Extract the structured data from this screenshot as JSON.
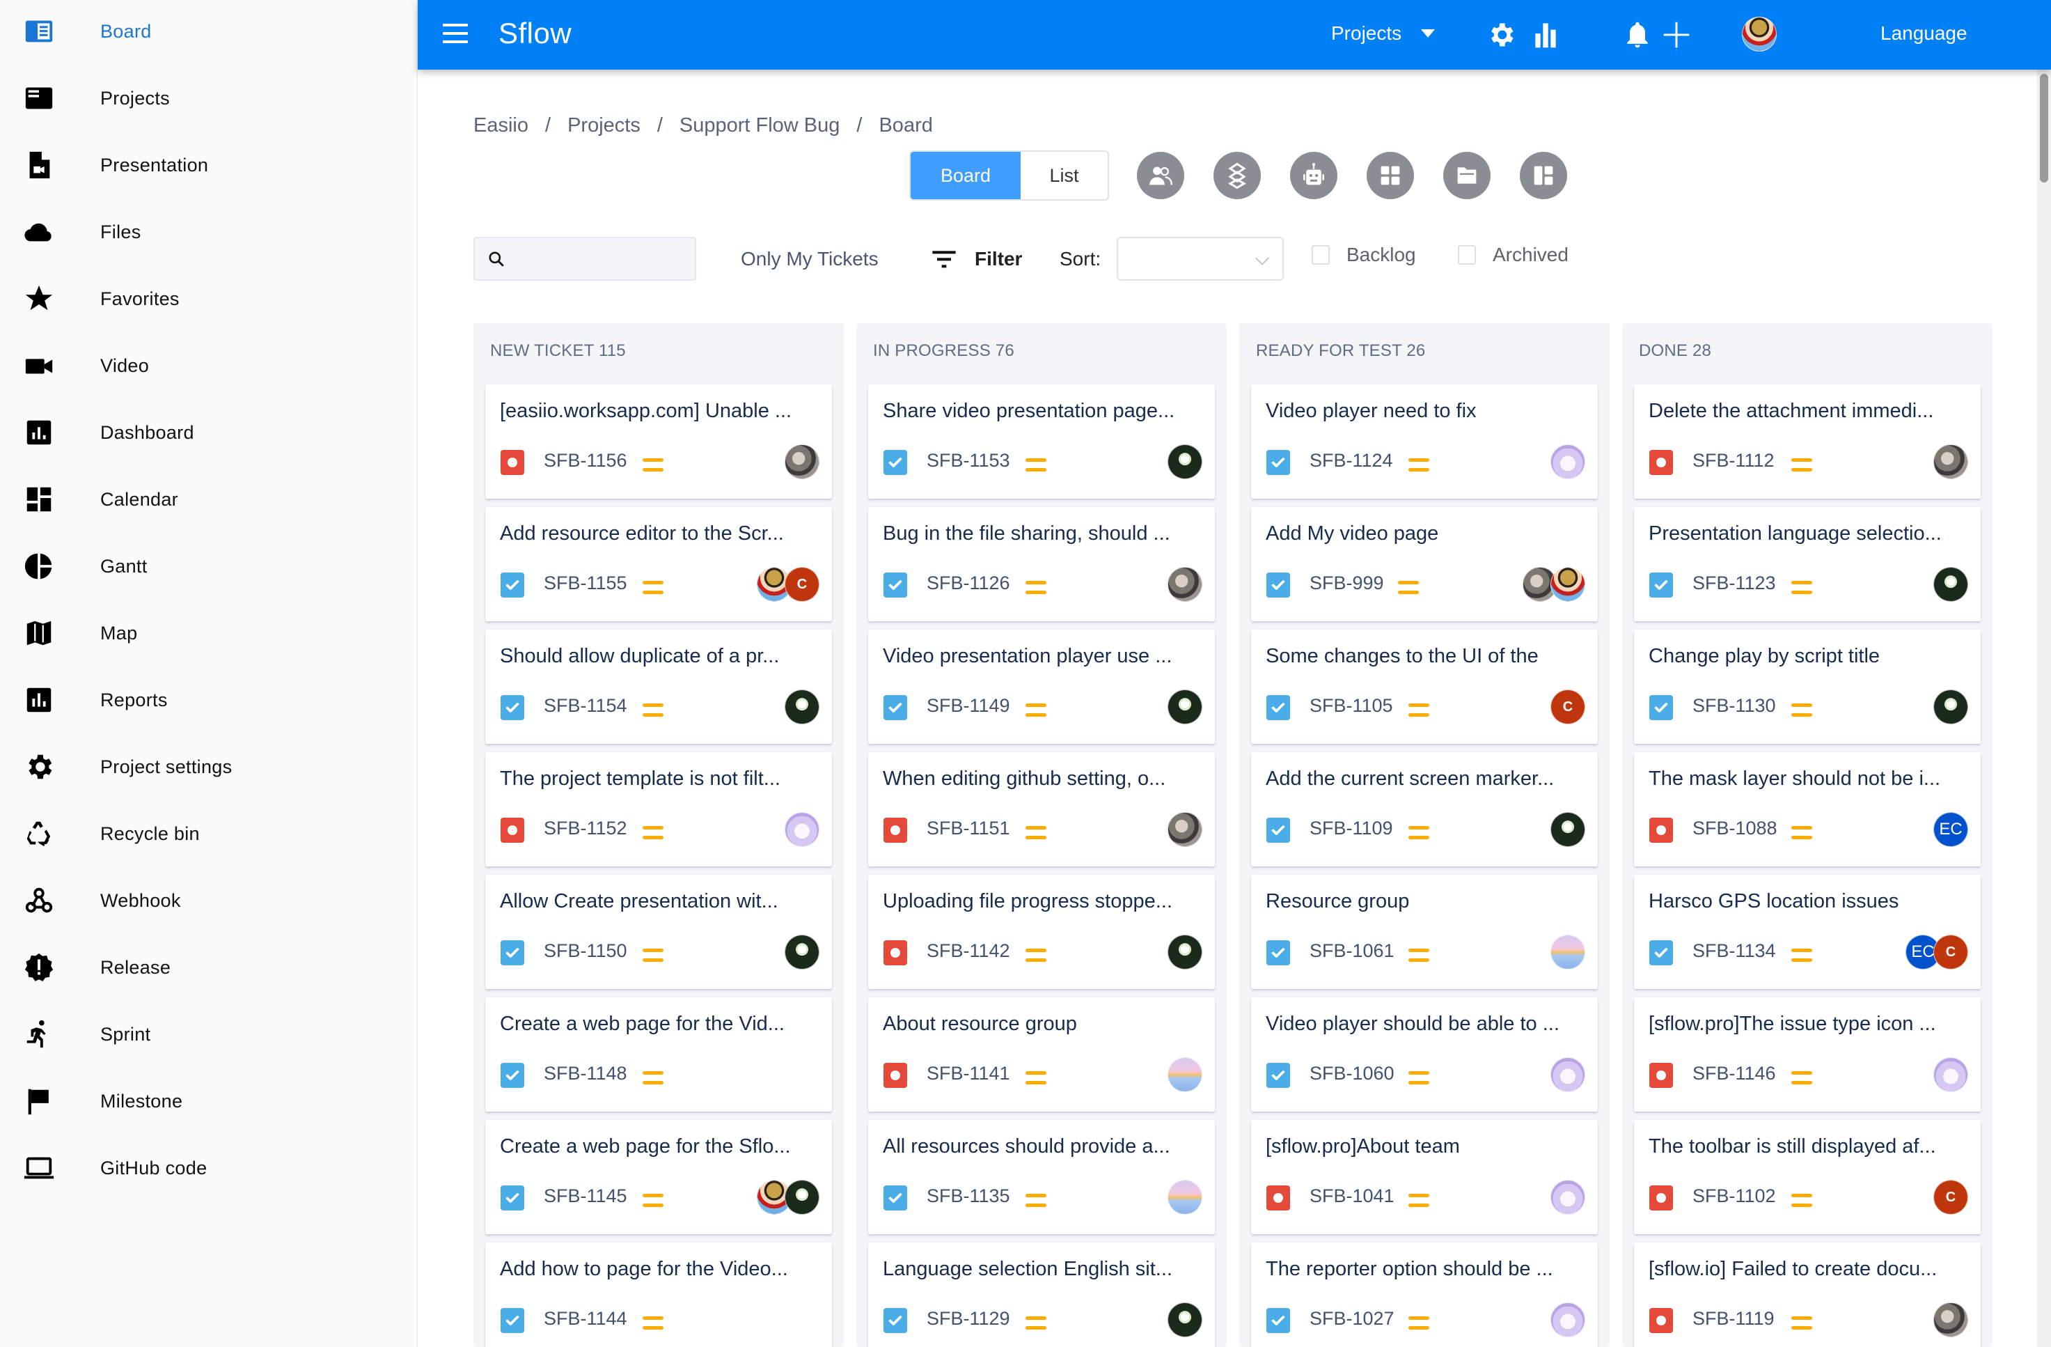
{
  "sidebar": {
    "items": [
      {
        "label": "Board",
        "icon": "board-icon",
        "active": true
      },
      {
        "label": "Projects",
        "icon": "projects-icon"
      },
      {
        "label": "Presentation",
        "icon": "presentation-icon"
      },
      {
        "label": "Files",
        "icon": "cloud-icon"
      },
      {
        "label": "Favorites",
        "icon": "star-icon"
      },
      {
        "label": "Video",
        "icon": "video-camera-icon"
      },
      {
        "label": "Dashboard",
        "icon": "dashboard-icon"
      },
      {
        "label": "Calendar",
        "icon": "calendar-grid-icon"
      },
      {
        "label": "Gantt",
        "icon": "pie-chart-icon"
      },
      {
        "label": "Map",
        "icon": "map-icon"
      },
      {
        "label": "Reports",
        "icon": "reports-icon"
      },
      {
        "label": "Project settings",
        "icon": "gear-icon"
      },
      {
        "label": "Recycle bin",
        "icon": "recycle-icon"
      },
      {
        "label": "Webhook",
        "icon": "webhook-icon"
      },
      {
        "label": "Release",
        "icon": "release-badge-icon"
      },
      {
        "label": "Sprint",
        "icon": "running-person-icon"
      },
      {
        "label": "Milestone",
        "icon": "flag-icon"
      },
      {
        "label": "GitHub code",
        "icon": "laptop-icon"
      }
    ]
  },
  "header": {
    "app_title": "Sflow",
    "projects_menu": "Projects",
    "language": "Language",
    "brand_color": "#0080f6"
  },
  "breadcrumb": [
    "Easiio",
    "Projects",
    "Support Flow Bug",
    "Board"
  ],
  "view_toggle": {
    "board": "Board",
    "list": "List",
    "active": "Board"
  },
  "toolbar": {
    "search_placeholder": "",
    "search_value": "",
    "only_my_tickets": "Only My Tickets",
    "filter": "Filter",
    "sort_label": "Sort:",
    "sort_value": "",
    "backlog": {
      "label": "Backlog",
      "checked": false
    },
    "archived": {
      "label": "Archived",
      "checked": false
    }
  },
  "columns": [
    {
      "title": "NEW TICKET 115",
      "cards": [
        {
          "title": "[easiio.worksapp.com] Unable ...",
          "key": "SFB-1156",
          "type": "bug",
          "priority": "medium",
          "assignees": [
            "gray"
          ]
        },
        {
          "title": "Add resource editor to the Scr...",
          "key": "SFB-1155",
          "type": "task",
          "priority": "medium",
          "assignees": [
            "luffy",
            "c"
          ]
        },
        {
          "title": "Should allow duplicate of a pr...",
          "key": "SFB-1154",
          "type": "task",
          "priority": "medium",
          "assignees": [
            "lotus"
          ]
        },
        {
          "title": "The project template is not filt...",
          "key": "SFB-1152",
          "type": "bug",
          "priority": "medium",
          "assignees": [
            "anime"
          ]
        },
        {
          "title": "Allow Create presentation wit...",
          "key": "SFB-1150",
          "type": "task",
          "priority": "medium",
          "assignees": [
            "lotus"
          ]
        },
        {
          "title": "Create a web page for the Vid...",
          "key": "SFB-1148",
          "type": "task",
          "priority": "medium",
          "assignees": []
        },
        {
          "title": "Create a web page for the Sflo...",
          "key": "SFB-1145",
          "type": "task",
          "priority": "medium",
          "assignees": [
            "luffy",
            "lotus"
          ]
        },
        {
          "title": "Add how to page for the Video...",
          "key": "SFB-1144",
          "type": "task",
          "priority": "medium",
          "assignees": []
        }
      ]
    },
    {
      "title": "IN PROGRESS 76",
      "cards": [
        {
          "title": "Share video presentation page...",
          "key": "SFB-1153",
          "type": "task",
          "priority": "medium",
          "assignees": [
            "lotus"
          ]
        },
        {
          "title": "Bug in the file sharing, should ...",
          "key": "SFB-1126",
          "type": "task",
          "priority": "medium",
          "assignees": [
            "gray"
          ]
        },
        {
          "title": "Video presentation player use ...",
          "key": "SFB-1149",
          "type": "task",
          "priority": "medium",
          "assignees": [
            "lotus"
          ]
        },
        {
          "title": "When editing github setting, o...",
          "key": "SFB-1151",
          "type": "bug",
          "priority": "medium",
          "assignees": [
            "gray"
          ]
        },
        {
          "title": "Uploading file progress stoppe...",
          "key": "SFB-1142",
          "type": "bug",
          "priority": "medium",
          "assignees": [
            "lotus"
          ]
        },
        {
          "title": "About resource group",
          "key": "SFB-1141",
          "type": "bug",
          "priority": "medium",
          "assignees": [
            "sky"
          ]
        },
        {
          "title": "All resources should provide a...",
          "key": "SFB-1135",
          "type": "task",
          "priority": "medium",
          "assignees": [
            "sky"
          ]
        },
        {
          "title": "Language selection English sit...",
          "key": "SFB-1129",
          "type": "task",
          "priority": "medium",
          "assignees": [
            "lotus"
          ]
        }
      ]
    },
    {
      "title": "READY FOR TEST 26",
      "cards": [
        {
          "title": "Video player need to fix",
          "key": "SFB-1124",
          "type": "task",
          "priority": "medium",
          "assignees": [
            "anime"
          ]
        },
        {
          "title": "Add My video page",
          "key": "SFB-999",
          "type": "task",
          "priority": "medium",
          "assignees": [
            "gray",
            "luffy"
          ]
        },
        {
          "title": "Some changes to the UI of the",
          "key": "SFB-1105",
          "type": "task",
          "priority": "medium",
          "assignees": [
            "c"
          ]
        },
        {
          "title": "Add the current screen marker...",
          "key": "SFB-1109",
          "type": "task",
          "priority": "medium",
          "assignees": [
            "lotus"
          ]
        },
        {
          "title": "Resource group",
          "key": "SFB-1061",
          "type": "task",
          "priority": "medium",
          "assignees": [
            "sky"
          ]
        },
        {
          "title": "Video player should be able to ...",
          "key": "SFB-1060",
          "type": "task",
          "priority": "medium",
          "assignees": [
            "anime"
          ]
        },
        {
          "title": "[sflow.pro]About team",
          "key": "SFB-1041",
          "type": "bug",
          "priority": "medium",
          "assignees": [
            "anime"
          ]
        },
        {
          "title": "The reporter option should be ...",
          "key": "SFB-1027",
          "type": "task",
          "priority": "medium",
          "assignees": [
            "anime"
          ]
        }
      ]
    },
    {
      "title": "DONE 28",
      "cards": [
        {
          "title": "Delete the attachment immedi...",
          "key": "SFB-1112",
          "type": "bug",
          "priority": "medium",
          "assignees": [
            "gray"
          ]
        },
        {
          "title": "Presentation language selectio...",
          "key": "SFB-1123",
          "type": "task",
          "priority": "medium",
          "assignees": [
            "lotus"
          ]
        },
        {
          "title": "Change play by script title",
          "key": "SFB-1130",
          "type": "task",
          "priority": "medium",
          "assignees": [
            "lotus"
          ]
        },
        {
          "title": "The mask layer should not be i...",
          "key": "SFB-1088",
          "type": "bug",
          "priority": "medium",
          "assignees": [
            "ec"
          ]
        },
        {
          "title": "Harsco GPS location issues",
          "key": "SFB-1134",
          "type": "task",
          "priority": "medium",
          "assignees": [
            "ec",
            "c"
          ]
        },
        {
          "title": "[sflow.pro]The issue type icon ...",
          "key": "SFB-1146",
          "type": "bug",
          "priority": "medium",
          "assignees": [
            "anime"
          ]
        },
        {
          "title": "The toolbar is still displayed af...",
          "key": "SFB-1102",
          "type": "bug",
          "priority": "medium",
          "assignees": [
            "c"
          ]
        },
        {
          "title": "[sflow.io] Failed to create docu...",
          "key": "SFB-1119",
          "type": "bug",
          "priority": "medium",
          "assignees": [
            "gray"
          ]
        }
      ]
    }
  ],
  "avatar_labels": {
    "c": "C",
    "ec": "EC"
  },
  "colors": {
    "bug": "#e5493a",
    "task": "#4bade8",
    "priority_medium": "#ffab00",
    "active_view": "#409eff",
    "avatar_c": "#bf360c",
    "avatar_ec": "#0052cc"
  }
}
